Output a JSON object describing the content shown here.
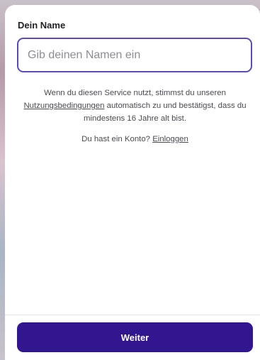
{
  "form": {
    "name_label": "Dein Name",
    "name_placeholder": "Gib deinen Namen ein",
    "name_value": ""
  },
  "terms": {
    "text_before": "Wenn du diesen Service nutzt, stimmst du unseren ",
    "link_label": "Nutzungsbedingungen",
    "text_after": " automatisch zu und bestätigst, dass du mindestens 16 Jahre alt bist."
  },
  "login": {
    "prompt": "Du hast ein Konto? ",
    "link_label": "Einloggen"
  },
  "footer": {
    "continue_label": "Weiter"
  },
  "colors": {
    "accent": "#32168f",
    "input_border": "#5a4bb8"
  }
}
